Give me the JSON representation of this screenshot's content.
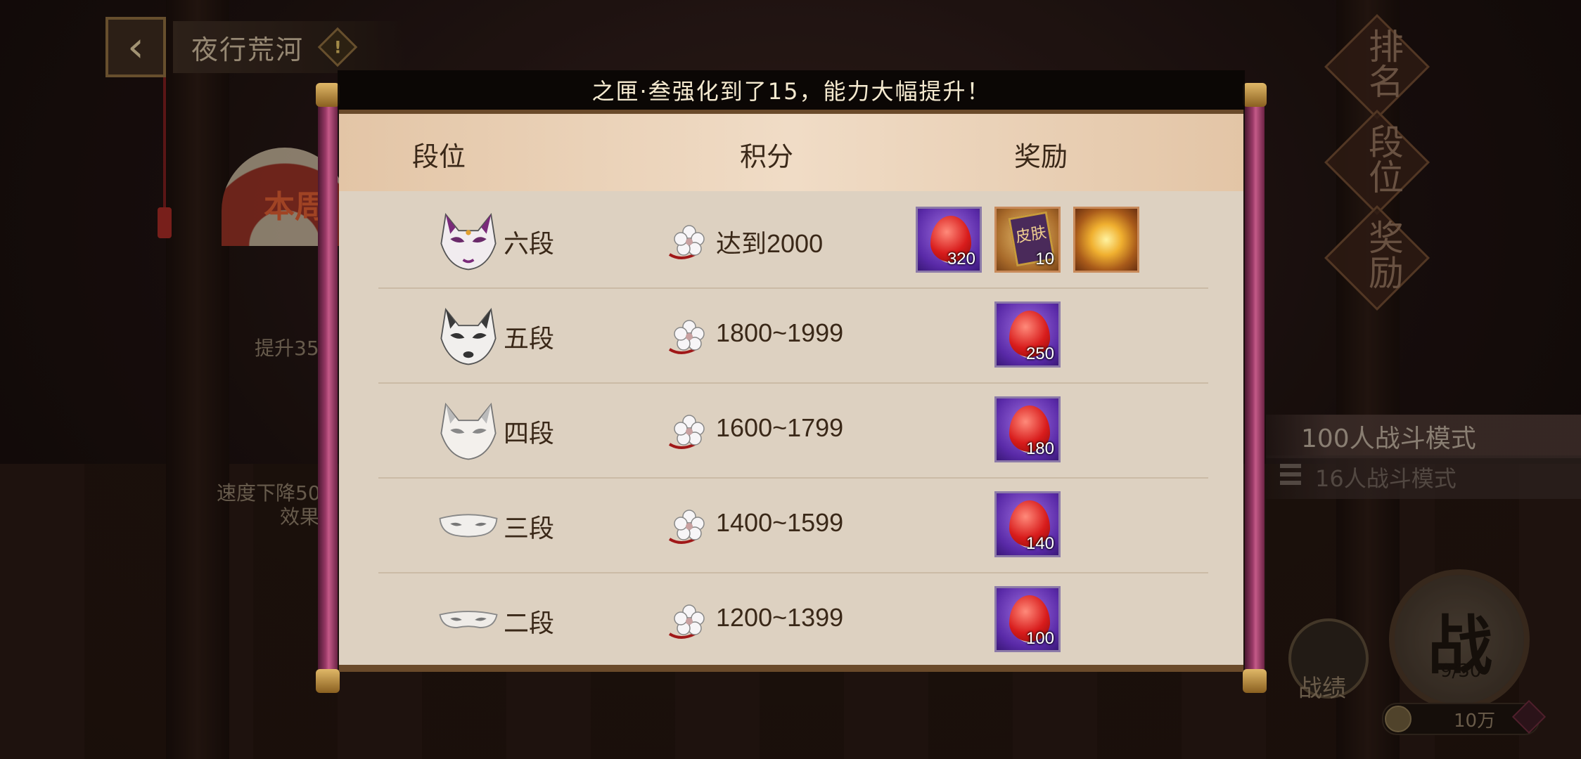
{
  "header": {
    "title": "夜行荒河",
    "info_glyph": "!"
  },
  "background": {
    "fan_text": "本周",
    "left_text_1": "提升35",
    "left_text_2": "速度下降50",
    "left_text_3": "效果"
  },
  "right_menu": [
    {
      "label": "排名"
    },
    {
      "label": "段位"
    },
    {
      "label": "奖励"
    }
  ],
  "modes": {
    "mode1": "100人战斗模式",
    "mode2": "16人战斗模式"
  },
  "battle": {
    "label": "战",
    "count": "9/30",
    "record_label": "战绩",
    "coin_value": "10万"
  },
  "notice": "之匣·叁强化到了15，能力大幅提升！",
  "table": {
    "headers": {
      "rank": "段位",
      "score": "积分",
      "reward": "奖励"
    },
    "rows": [
      {
        "rank": "六段",
        "score": "达到2000",
        "mask": "purple-fox-mask-icon",
        "rewards": [
          {
            "type": "soul-jade",
            "qty": "320"
          },
          {
            "type": "skin-scroll",
            "qty": "10"
          },
          {
            "type": "golden-frame",
            "qty": ""
          }
        ]
      },
      {
        "rank": "五段",
        "score": "1800~1999",
        "mask": "black-fox-mask-icon",
        "rewards": [
          {
            "type": "soul-jade",
            "qty": "250"
          }
        ]
      },
      {
        "rank": "四段",
        "score": "1600~1799",
        "mask": "white-fox-mask-icon",
        "rewards": [
          {
            "type": "soul-jade",
            "qty": "180"
          }
        ]
      },
      {
        "rank": "三段",
        "score": "1400~1599",
        "mask": "half-mask-icon",
        "rewards": [
          {
            "type": "soul-jade",
            "qty": "140"
          }
        ]
      },
      {
        "rank": "二段",
        "score": "1200~1399",
        "mask": "eye-mask-icon",
        "rewards": [
          {
            "type": "soul-jade",
            "qty": "100"
          }
        ]
      }
    ]
  },
  "colors": {
    "panel_bg": "#ddd1c1",
    "rod": "#9a3a68",
    "reward_purple": "#5a2aa8",
    "text_dark": "#3a2818"
  },
  "skin_scroll_glyph": "皮肤"
}
